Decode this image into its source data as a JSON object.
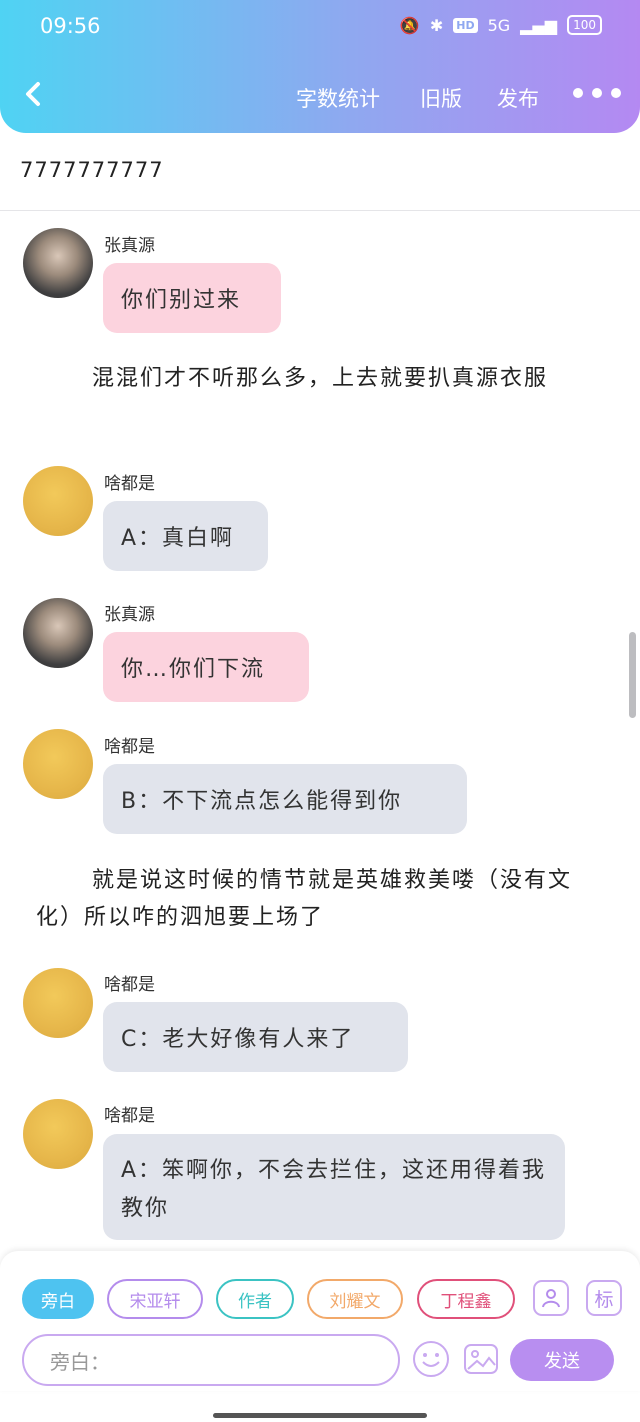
{
  "status": {
    "time": "09:56",
    "signal": "5G",
    "battery": "100"
  },
  "header": {
    "word_count": "字数统计",
    "old_version": "旧版",
    "publish": "发布"
  },
  "story_title": "7777777777",
  "messages": [
    {
      "type": "chat",
      "speaker": "张真源",
      "text": "你们别过来",
      "color": "#fcd3de"
    },
    {
      "type": "narration",
      "text": "混混们才不听那么多，上去就要扒真源衣服"
    },
    {
      "type": "chat",
      "speaker": "啥都是",
      "text": "A：真白啊",
      "color": "#e1e4ec"
    },
    {
      "type": "chat",
      "speaker": "张真源",
      "text": "你…你们下流",
      "color": "#fcd3de"
    },
    {
      "type": "chat",
      "speaker": "啥都是",
      "text": "B：不下流点怎么能得到你",
      "color": "#e1e4ec"
    },
    {
      "type": "narration",
      "text": "就是说这时候的情节就是英雄救美喽（没有文化）所以咋的泗旭要上场了"
    },
    {
      "type": "chat",
      "speaker": "啥都是",
      "text": "C：老大好像有人来了",
      "color": "#e1e4ec"
    },
    {
      "type": "chat",
      "speaker": "啥都是",
      "text": "A：笨啊你，不会去拦住，这还用得着我教你",
      "color": "#e1e4ec"
    }
  ],
  "roles": [
    {
      "label": "旁白",
      "color": "#4ec3f0",
      "active": true
    },
    {
      "label": "宋亚轩",
      "color": "#b48cec",
      "active": false
    },
    {
      "label": "作者",
      "color": "#3bc3c3",
      "active": false
    },
    {
      "label": "刘耀文",
      "color": "#f2a96a",
      "active": false
    },
    {
      "label": "丁程鑫",
      "color": "#e0507a",
      "active": false
    }
  ],
  "tag_button": "标",
  "input": {
    "placeholder": "旁白："
  },
  "send_label": "发送"
}
